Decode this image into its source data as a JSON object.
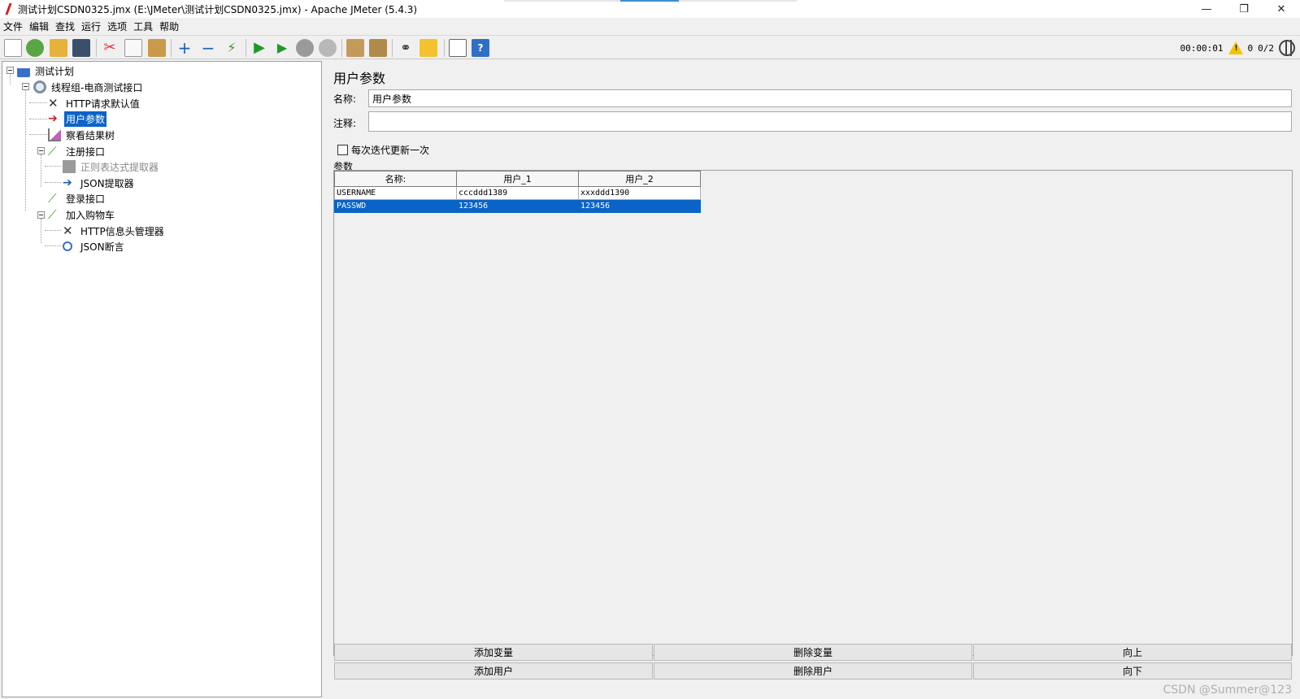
{
  "window": {
    "title": "测试计划CSDN0325.jmx (E:\\JMeter\\测试计划CSDN0325.jmx) - Apache JMeter (5.4.3)",
    "minimize": "—",
    "maximize": "❐",
    "close": "✕"
  },
  "menu": [
    "文件",
    "编辑",
    "查找",
    "运行",
    "选项",
    "工具",
    "帮助"
  ],
  "toolbar": {
    "icons": [
      "new-icon",
      "templates-icon",
      "open-icon",
      "save-icon",
      "cut-icon",
      "copy-icon",
      "paste-icon",
      "expand-icon",
      "collapse-icon",
      "toggle-icon",
      "start-icon",
      "start-no-pause-icon",
      "stop-icon",
      "shutdown-icon",
      "clear-icon",
      "clear-all-icon",
      "search-icon",
      "reset-search-icon",
      "function-helper-icon",
      "help-icon"
    ],
    "timer": "00:00:01",
    "warnings": "0",
    "threads": "0/2"
  },
  "tree": {
    "items": [
      {
        "label": "测试计划",
        "icon": "test-plan-icon"
      },
      {
        "label": "线程组-电商测试接口",
        "icon": "thread-group-icon"
      },
      {
        "label": "HTTP请求默认值",
        "icon": "config-icon"
      },
      {
        "label": "用户参数",
        "icon": "preprocessor-icon"
      },
      {
        "label": "察看结果树",
        "icon": "listener-icon"
      },
      {
        "label": "注册接口",
        "icon": "sampler-icon"
      },
      {
        "label": "正则表达式提取器",
        "icon": "postprocessor-icon"
      },
      {
        "label": "JSON提取器",
        "icon": "postprocessor-icon"
      },
      {
        "label": "登录接口",
        "icon": "sampler-icon"
      },
      {
        "label": "加入购物车",
        "icon": "sampler-icon"
      },
      {
        "label": "HTTP信息头管理器",
        "icon": "config-icon"
      },
      {
        "label": "JSON断言",
        "icon": "assertion-icon"
      }
    ]
  },
  "panel": {
    "title": "用户参数",
    "name_label": "名称:",
    "name_value": "用户参数",
    "comment_label": "注释:",
    "comment_value": "",
    "checkbox_label": "每次迭代更新一次",
    "params_label": "参数"
  },
  "table": {
    "headers": [
      "名称:",
      "用户_1",
      "用户_2"
    ],
    "rows": [
      [
        "USERNAME",
        "cccddd1389",
        "xxxddd1390"
      ],
      [
        "PASSWD",
        "123456",
        "123456"
      ]
    ]
  },
  "buttons": {
    "add_variable": "添加变量",
    "delete_variable": "删除变量",
    "move_up": "向上",
    "add_user": "添加用户",
    "delete_user": "删除用户",
    "move_down": "向下"
  },
  "watermark": "CSDN @Summer@123",
  "colors": {
    "selection": "#0a63c7"
  }
}
